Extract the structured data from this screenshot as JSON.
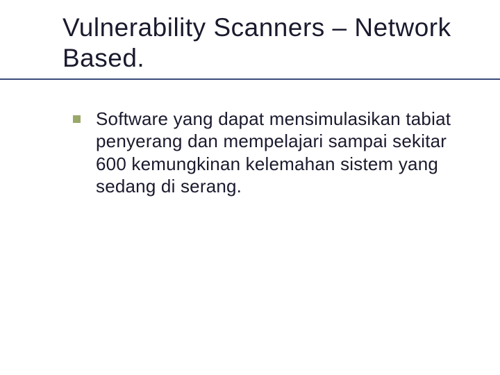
{
  "slide": {
    "title": "Vulnerability Scanners – Network Based.",
    "bullets": [
      {
        "text": "Software yang dapat mensimulasikan tabiat penyerang dan mempelajari sampai sekitar 600 kemungkinan kelemahan sistem yang sedang di serang."
      }
    ]
  }
}
